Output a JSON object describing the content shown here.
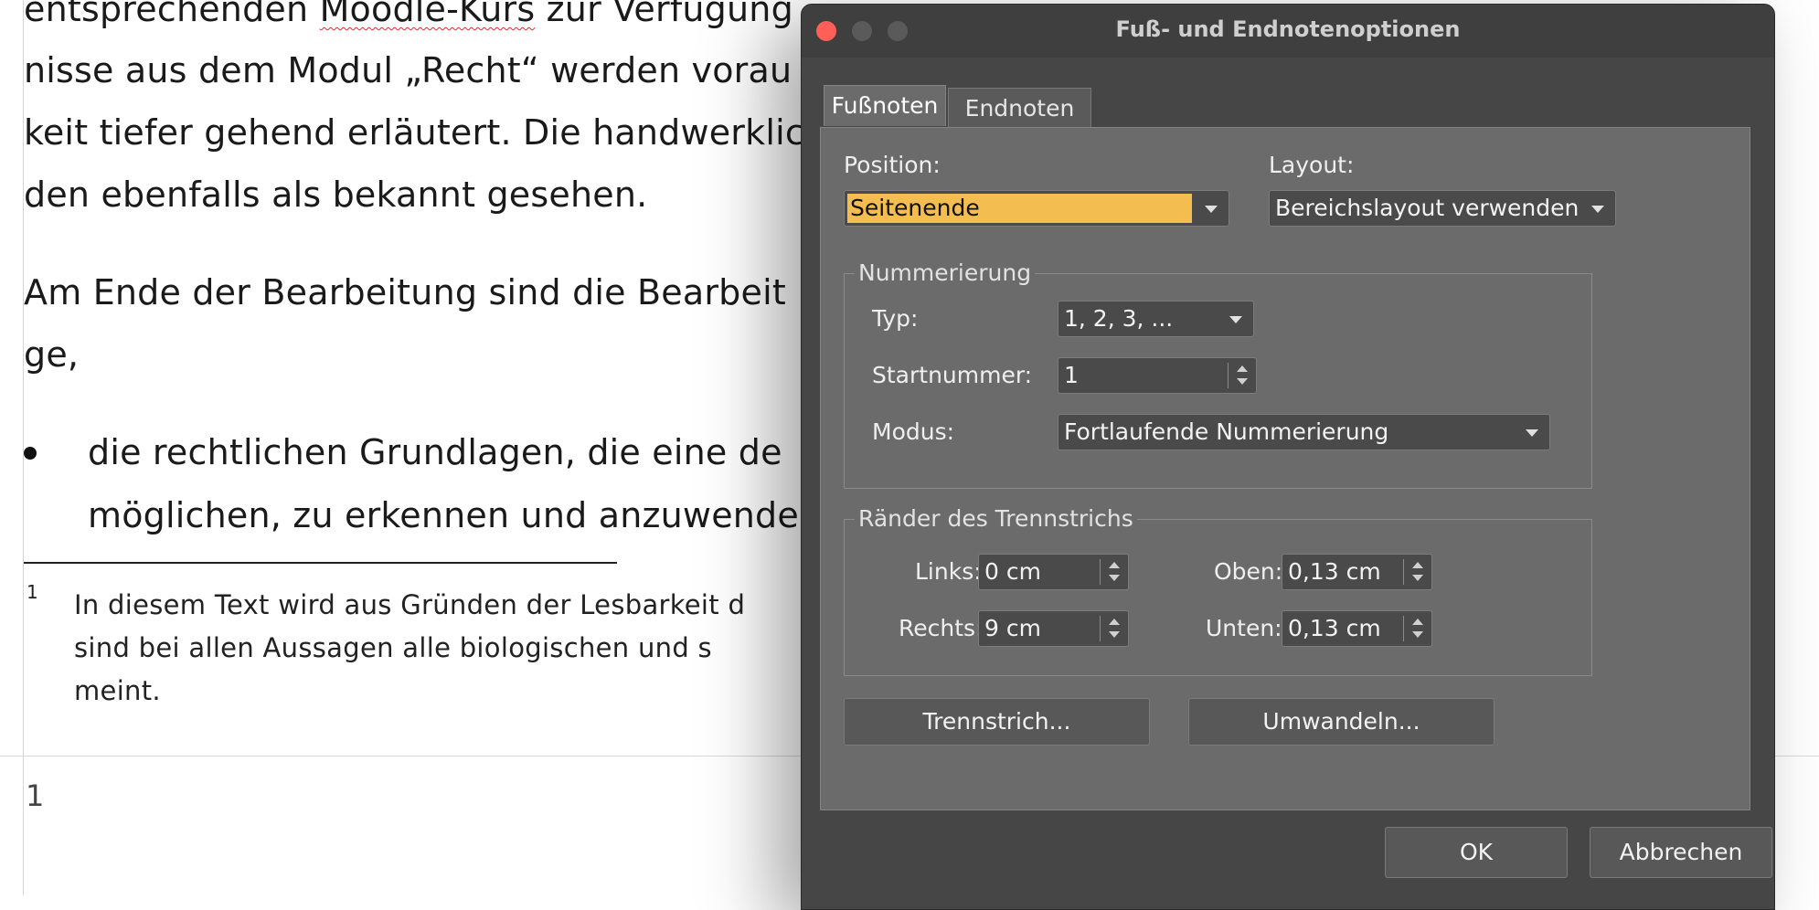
{
  "document": {
    "lines": [
      "entsprechenden Moodle-Kurs zur Verfügung",
      "nisse aus dem Modul „Recht“ werden vorau",
      "keit tiefer gehend erläutert. Die handwerklic",
      "den ebenfalls als bekannt gesehen.",
      "Am Ende der Bearbeitung sind die Bearbeit",
      "ge,",
      "die rechtlichen Grundlagen, die eine de",
      "möglichen, zu erkennen und anzuwende"
    ],
    "misspelled_word": "Moodle-Kurs",
    "footnote_number": "1",
    "footnote_lines": [
      "In diesem Text wird aus Gründen der Lesbarkeit d",
      "sind bei allen Aussagen alle biologischen und s",
      "meint."
    ],
    "page_number": "1"
  },
  "dialog": {
    "title": "Fuß- und Endnotenoptionen",
    "tabs": {
      "footnotes": "Fußnoten",
      "endnotes": "Endnoten"
    },
    "position_label": "Position:",
    "position_value": "Seitenende",
    "layout_label": "Layout:",
    "layout_value": "Bereichslayout verwenden",
    "numbering": {
      "title": "Nummerierung",
      "type_label": "Typ:",
      "type_value": "1, 2, 3, ...",
      "start_label": "Startnummer:",
      "start_value": "1",
      "mode_label": "Modus:",
      "mode_value": "Fortlaufende Nummerierung"
    },
    "margins": {
      "title": "Ränder des Trennstrichs",
      "left_label": "Links:",
      "left_value": "0 cm",
      "right_label": "Rechts:",
      "right_value": "9 cm",
      "top_label": "Oben:",
      "top_value": "0,13 cm",
      "bottom_label": "Unten:",
      "bottom_value": "0,13 cm"
    },
    "separator_button": "Trennstrich...",
    "convert_button": "Umwandeln...",
    "ok_button": "OK",
    "cancel_button": "Abbrechen"
  },
  "colors": {
    "dialog_bg": "#464646",
    "panel_bg": "#6b6b6b",
    "highlight": "#f3be4f",
    "close_button": "#ff5f57"
  }
}
